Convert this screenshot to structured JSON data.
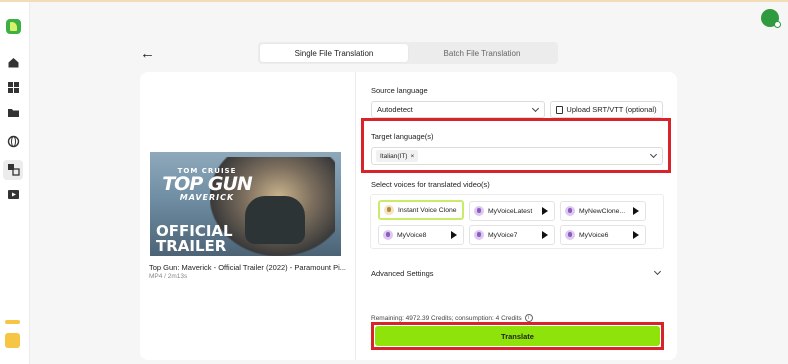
{
  "tabs": [
    {
      "label": "Single File Translation",
      "active": true
    },
    {
      "label": "Batch File Translation",
      "active": false
    }
  ],
  "video": {
    "thumbnail_text": {
      "star": "TOM CRUISE",
      "title": "TOP GUN",
      "subtitle": "MAVERICK",
      "banner_line1": "OFFICIAL",
      "banner_line2": "TRAILER"
    },
    "title": "Top Gun: Maverick - Official Trailer (2022) - Paramount Pi...",
    "meta": "MP4 / 2m13s"
  },
  "source": {
    "label": "Source language",
    "value": "Autodetect"
  },
  "upload": {
    "label": "Upload SRT/VTT (optional)"
  },
  "target": {
    "label": "Target language(s)",
    "chips": [
      {
        "label": "Italian(IT)"
      }
    ]
  },
  "voices": {
    "label": "Select voices for translated video(s)",
    "items": [
      {
        "name": "Instant Voice Clone",
        "selected": true,
        "icon": "voice-clone-icon"
      },
      {
        "name": "MyVoiceLatest",
        "selected": false,
        "icon": "voice-avatar-icon"
      },
      {
        "name": "MyNewClone...",
        "selected": false,
        "icon": "voice-avatar-icon"
      },
      {
        "name": "MyVoice8",
        "selected": false,
        "icon": "voice-avatar-icon"
      },
      {
        "name": "MyVoice7",
        "selected": false,
        "icon": "voice-avatar-icon"
      },
      {
        "name": "MyVoice6",
        "selected": false,
        "icon": "voice-avatar-icon"
      }
    ]
  },
  "advanced": {
    "label": "Advanced Settings"
  },
  "credits": {
    "text": "Remaining: 4972.39 Credits; consumption: 4 Credits"
  },
  "actions": {
    "translate_label": "Translate"
  },
  "colors": {
    "accent": "#8ee40a",
    "highlight_border": "#d8232a",
    "brand": "#3cb043"
  }
}
